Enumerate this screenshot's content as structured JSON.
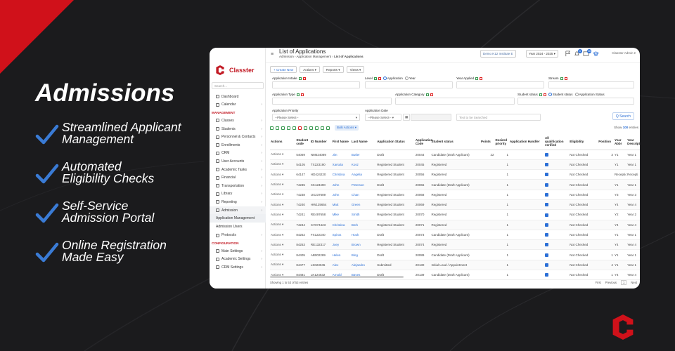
{
  "hero": {
    "title": "Admissions",
    "features": [
      {
        "line1": "Streamlined Applicant",
        "line2": "Management"
      },
      {
        "line1": "Automated",
        "line2": "Eligibility Checks"
      },
      {
        "line1": "Self-Service",
        "line2": "Admission Portal"
      },
      {
        "line1": "Online Registration",
        "line2": "Made Easy"
      }
    ]
  },
  "colors": {
    "accent_red": "#d0111a",
    "check_blue": "#3a7bd5",
    "link_blue": "#2b6fd6"
  },
  "app": {
    "brand": "Classter",
    "search_placeholder": "Search...",
    "nav": {
      "items_top": [
        "Dashboard",
        "Calendar"
      ],
      "section_management": "MANAGEMENT",
      "items_management": [
        "Classes",
        "Students",
        "Personnel & Contacts",
        "Enrollments",
        "CRM",
        "User Accounts",
        "Academic Tasks",
        "Financial",
        "Transportation",
        "Library",
        "Reporting",
        "Admission"
      ],
      "admission_sub": [
        "Application Management",
        "Admission Users"
      ],
      "items_after": [
        "Protocols"
      ],
      "section_configuration": "CONFIGURATION",
      "items_config": [
        "Main Settings",
        "Academic Settings",
        "CRM Settings"
      ]
    },
    "topbar": {
      "title": "List of Applications",
      "breadcrumb_root": "Admission",
      "breadcrumb_mid": "Application Management",
      "breadcrumb_current": "List of Applications",
      "institute": "Demo K12 Institute E",
      "year": "Year 2024 - 2025",
      "badge1": "6",
      "badge2": "38",
      "user": "Classter Admin"
    },
    "toolbar": {
      "create": "+ Create New",
      "actions": "Actions",
      "reports": "Reports",
      "views": "Views"
    },
    "filters": {
      "application_intake": "Application Intake",
      "level": "Level",
      "level_opt1": "Application",
      "level_opt2": "Year",
      "year_applied": "Year Applied",
      "stream": "Stream",
      "application_type": "Application Type",
      "application_category": "Application Category",
      "student_status": "Student status",
      "status_opt1": "Student status",
      "status_opt2": "Application Status",
      "application_priority": "Application Priority",
      "priority_placeholder": "--Please Select--",
      "application_date": "Application Date",
      "date_placeholder": "--Please Select--",
      "text_placeholder": "Text to be Searched",
      "search_button": "Q Search"
    },
    "grid": {
      "bulk": "Bulk Actions",
      "show_label": "Show",
      "show_value": "100",
      "show_suffix": "entries",
      "columns": [
        "Actions",
        "Student code",
        "ID Number",
        "First Name",
        "Last Name",
        "Application Status",
        "Application Code",
        "Student status",
        "Points",
        "Desired priority",
        "Application Handler",
        "All qualification verified",
        "Eligibility",
        "Position",
        "Year Abbr",
        "Year Description"
      ],
      "rows": [
        [
          "Actions",
          "54069",
          "NM524089",
          "Jim",
          "Butler",
          "Draft",
          "20044",
          "Candidate (Draft Applicant)",
          "22",
          "1",
          "",
          "",
          "Not Checked",
          "3",
          "Y1",
          "Year 1"
        ],
        [
          "Actions",
          "54105",
          "TX223190",
          "Xarsula",
          "Kosz",
          "Registered Student",
          "20045",
          "Registered",
          "",
          "1",
          "",
          "",
          "Not Checked",
          "",
          "Y1",
          "Year 1"
        ],
        [
          "Actions",
          "64147",
          "HD424220",
          "Christina",
          "Angelia",
          "Registered Student",
          "20056",
          "Registered",
          "",
          "1",
          "",
          "",
          "Not Checked",
          "",
          "Reception",
          "Recepti"
        ],
        [
          "Actions",
          "74235",
          "XK123490",
          "John",
          "Peterson",
          "Draft",
          "20066",
          "Candidate (Draft Applicant)",
          "",
          "1",
          "",
          "",
          "Not Checked",
          "",
          "Y1",
          "Year 1"
        ],
        [
          "Actions",
          "74238",
          "UX237689",
          "John",
          "Chan",
          "Registered Student",
          "20068",
          "Registered",
          "",
          "1",
          "",
          "",
          "Not Checked",
          "",
          "Y3",
          "Year 3"
        ],
        [
          "Actions",
          "74240",
          "HW135654",
          "Matt",
          "Green",
          "Registered Student",
          "20069",
          "Registered",
          "",
          "1",
          "",
          "",
          "Not Checked",
          "",
          "Y4",
          "Year 4"
        ],
        [
          "Actions",
          "74241",
          "RE497658",
          "Mike",
          "Smith",
          "Registered Student",
          "20070",
          "Registered",
          "",
          "1",
          "",
          "",
          "Not Checked",
          "",
          "Y2",
          "Year 2"
        ],
        [
          "Actions",
          "74244",
          "CV074423",
          "Christina",
          "Berk",
          "Registered Student",
          "20071",
          "Registered",
          "",
          "1",
          "",
          "",
          "Not Checked",
          "",
          "Y4",
          "Year 4"
        ],
        [
          "Actions",
          "84252",
          "FX122340",
          "Spiros",
          "Hook",
          "Draft",
          "20073",
          "Candidate (Draft Applicant)",
          "",
          "1",
          "",
          "",
          "Not Checked",
          "",
          "Y1",
          "Year 1"
        ],
        [
          "Actions",
          "84253",
          "RE132317",
          "Joey",
          "Brown",
          "Registered Student",
          "20074",
          "Registered",
          "",
          "1",
          "",
          "",
          "Not Checked",
          "",
          "Y4",
          "Year 4"
        ],
        [
          "Actions",
          "84405",
          "AB002289",
          "Helen",
          "Bing",
          "Draft",
          "20089",
          "Candidate (Draft Applicant)",
          "",
          "1",
          "",
          "",
          "Not Checked",
          "1",
          "Y1",
          "Year 1"
        ],
        [
          "Actions",
          "84477",
          "LS023045",
          "Alex",
          "Alejandro",
          "Submitted",
          "20130",
          "Initial Lead / Appointment",
          "",
          "1",
          "",
          "",
          "Not Checked",
          "4",
          "Y1",
          "Year 1"
        ],
        [
          "Actions",
          "84481",
          "LK124632",
          "Arnold",
          "Bayes",
          "Draft",
          "20139",
          "Candidate (Draft Applicant)",
          "",
          "1",
          "",
          "",
          "Not Checked",
          "1",
          "Y4",
          "Year 4"
        ]
      ],
      "footer": "Showing 1 to 53 of 53 entries",
      "pager": [
        "First",
        "Previous",
        "1",
        "Next"
      ]
    }
  }
}
